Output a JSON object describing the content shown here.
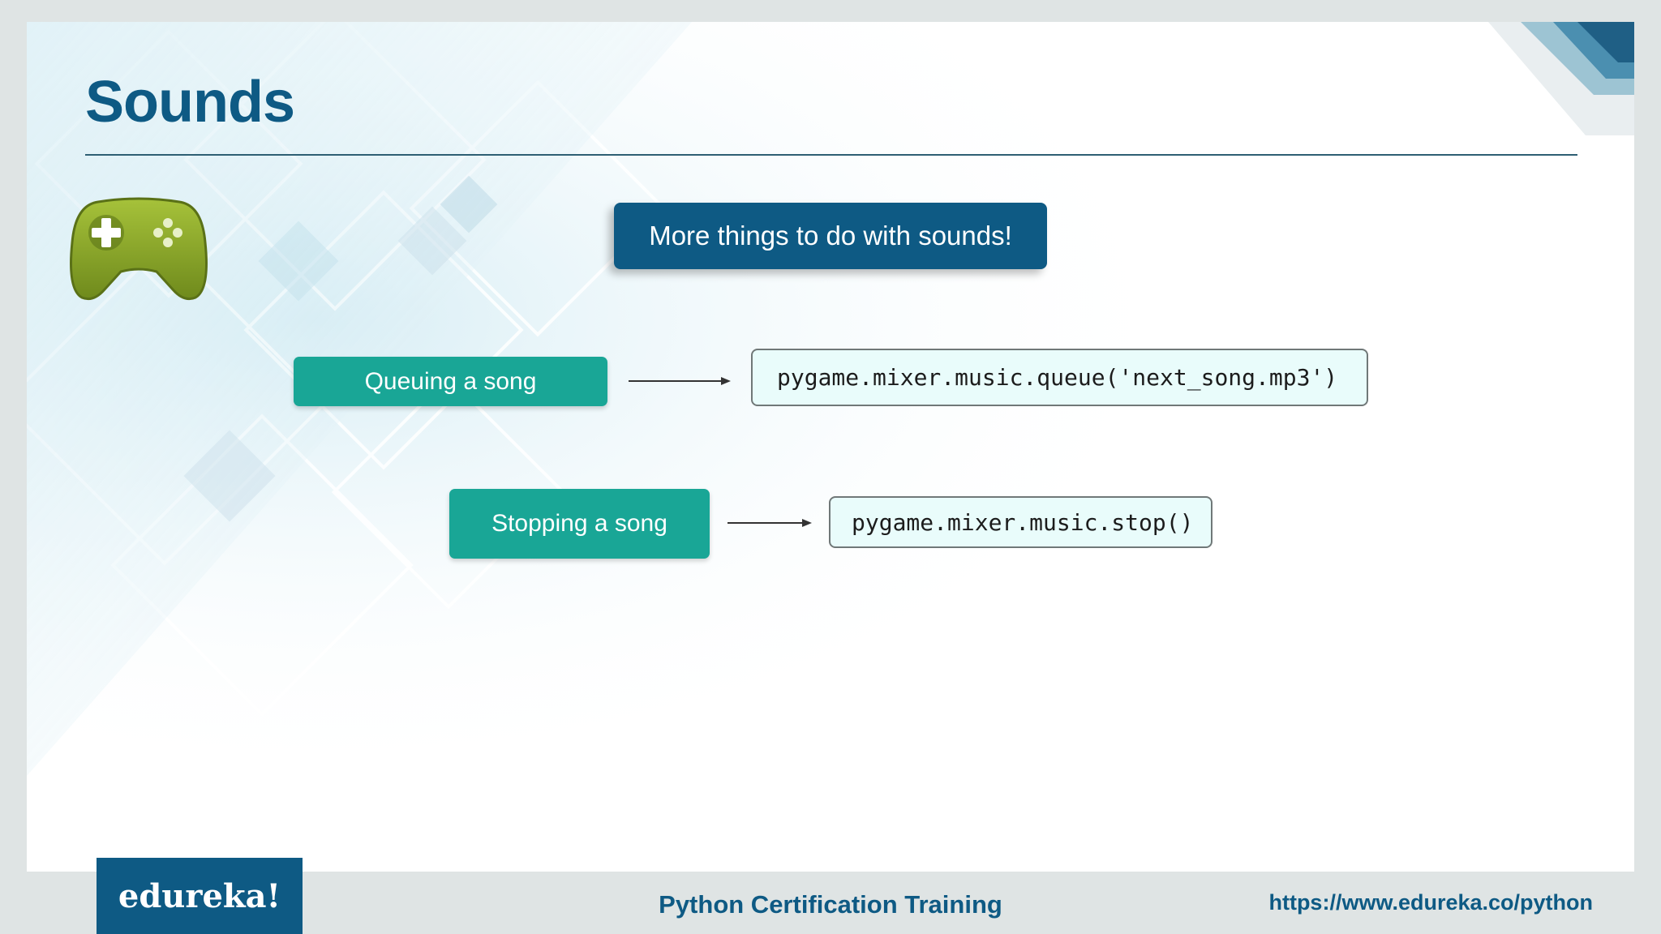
{
  "slide": {
    "title": "Sounds",
    "headline": "More things to do with sounds!",
    "items": [
      {
        "label": "Queuing a song",
        "code": "pygame.mixer.music.queue('next_song.mp3')"
      },
      {
        "label": "Stopping a song",
        "code": "pygame.mixer.music.stop()"
      }
    ]
  },
  "footer": {
    "logo": "edureka!",
    "course": "Python Certification Training",
    "url": "https://www.edureka.co/python"
  },
  "colors": {
    "brand_blue": "#0e5a84",
    "teal": "#19a696",
    "code_bg": "#e9fcfb",
    "gamepad_green": "#8aa52a"
  },
  "icons": {
    "gamepad": "gamepad-icon",
    "arrows": "arrow-right-icon"
  }
}
